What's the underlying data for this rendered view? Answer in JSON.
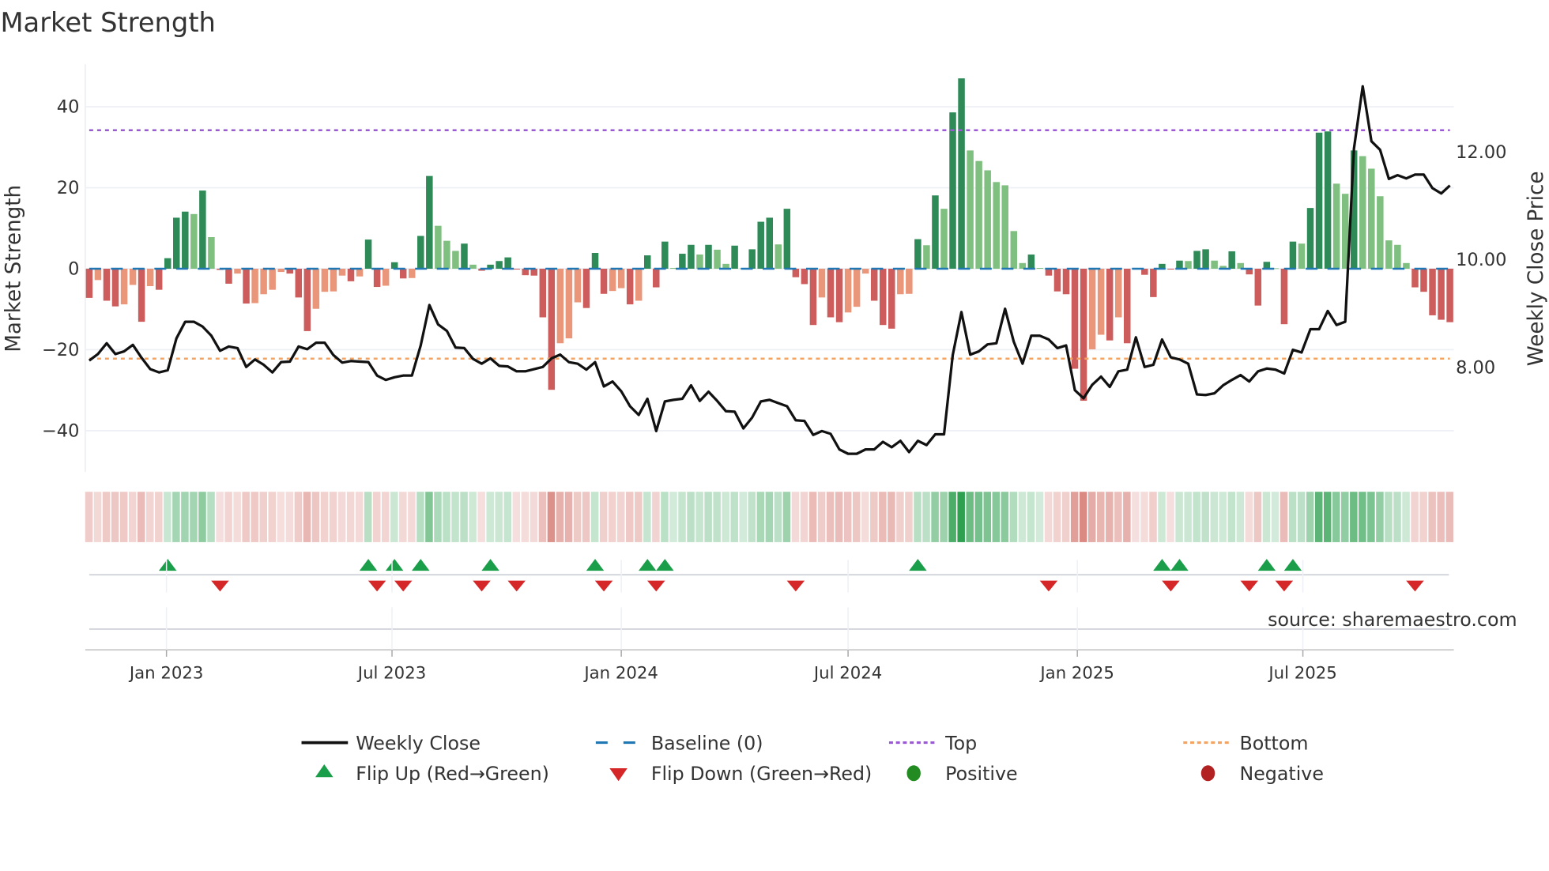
{
  "title": "Market Strength",
  "source": "source: sharemaestro.com",
  "chart_data": {
    "type": "bar",
    "frequency": "weekly",
    "xlim": [
      "2022-10-31",
      "2025-10-27"
    ],
    "x_ticks": [
      {
        "date": "2023-01-01",
        "label": "Jan 2023"
      },
      {
        "date": "2023-07-01",
        "label": "Jul 2023"
      },
      {
        "date": "2024-01-01",
        "label": "Jan 2024"
      },
      {
        "date": "2024-07-01",
        "label": "Jul 2024"
      },
      {
        "date": "2025-01-01",
        "label": "Jan 2025"
      },
      {
        "date": "2025-07-01",
        "label": "Jul 2025"
      }
    ],
    "left_axis": {
      "label": "Market Strength",
      "ylim": [
        -50.2,
        50.5
      ],
      "ticks": [
        40,
        20,
        0,
        -20,
        -40
      ],
      "tick_labels": [
        "40",
        "20",
        "0",
        "−20",
        "−40"
      ]
    },
    "right_axis": {
      "label": "Weekly Close Price",
      "ylim": [
        6.06,
        13.63
      ],
      "ticks": [
        12,
        10,
        8
      ],
      "tick_labels": [
        "12.00",
        "10.00",
        "8.00"
      ]
    },
    "grid": true,
    "baseline": 0,
    "top_level": 34.2,
    "bottom_level": -22.2,
    "strength": [
      -7.2,
      -2.8,
      -7.9,
      -9.3,
      -8.8,
      -4.0,
      -13.1,
      -4.3,
      -5.2,
      2.6,
      12.6,
      14.1,
      13.5,
      19.3,
      7.8,
      -0.3,
      -3.7,
      -1.2,
      -8.6,
      -8.5,
      -6.3,
      -5.2,
      -0.8,
      -1.2,
      -7.1,
      -15.4,
      -9.9,
      -5.7,
      -5.6,
      -1.7,
      -3.1,
      -1.9,
      7.2,
      -4.5,
      -4.2,
      1.6,
      -2.4,
      -2.3,
      8.1,
      22.9,
      10.6,
      6.9,
      4.4,
      6.2,
      1.0,
      -0.5,
      1.0,
      1.9,
      2.8,
      -0.2,
      -1.6,
      -1.7,
      -12.0,
      -29.9,
      -18.4,
      -17.2,
      -8.3,
      -9.7,
      3.9,
      -6.2,
      -5.5,
      -4.8,
      -8.8,
      -7.9,
      3.3,
      -4.6,
      6.7,
      0.2,
      3.7,
      5.9,
      3.5,
      5.9,
      4.7,
      1.2,
      5.7,
      0.1,
      4.8,
      11.6,
      12.6,
      6.0,
      14.8,
      -2.1,
      -3.8,
      -13.9,
      -7.1,
      -12.0,
      -13.2,
      -10.8,
      -9.4,
      -1.2,
      -7.9,
      -13.9,
      -14.8,
      -6.3,
      -6.2,
      7.3,
      5.8,
      18.1,
      14.8,
      38.6,
      47.0,
      29.2,
      26.6,
      24.3,
      21.4,
      20.6,
      9.3,
      1.4,
      3.5,
      0.2,
      -1.7,
      -5.6,
      -6.3,
      -24.7,
      -32.6,
      -19.9,
      -16.3,
      -17.7,
      -12.0,
      -18.4,
      -0.2,
      -1.5,
      -7.0,
      1.2,
      -0.2,
      2.0,
      1.9,
      4.4,
      4.8,
      2.0,
      0.7,
      4.3,
      1.4,
      -1.4,
      -9.1,
      1.7,
      0.1,
      -13.7,
      6.7,
      6.2,
      15.0,
      33.6,
      33.9,
      21.0,
      18.5,
      29.2,
      27.8,
      24.7,
      17.9,
      7.0,
      5.9,
      1.4,
      -4.6,
      -5.7,
      -11.5,
      -12.6,
      -13.2
    ],
    "weekly_close": [
      8.13,
      8.25,
      8.45,
      8.25,
      8.3,
      8.42,
      8.18,
      7.97,
      7.91,
      7.95,
      8.54,
      8.85,
      8.85,
      8.76,
      8.59,
      8.31,
      8.39,
      8.36,
      8.01,
      8.15,
      8.05,
      7.91,
      8.1,
      8.11,
      8.39,
      8.34,
      8.46,
      8.46,
      8.23,
      8.09,
      8.12,
      8.11,
      8.1,
      7.85,
      7.77,
      7.82,
      7.85,
      7.85,
      8.41,
      9.16,
      8.8,
      8.68,
      8.37,
      8.36,
      8.16,
      8.07,
      8.17,
      8.03,
      8.02,
      7.93,
      7.93,
      7.97,
      8.01,
      8.17,
      8.24,
      8.1,
      8.07,
      7.96,
      8.1,
      7.65,
      7.74,
      7.56,
      7.28,
      7.12,
      7.42,
      6.82,
      7.37,
      7.4,
      7.42,
      7.67,
      7.38,
      7.55,
      7.38,
      7.19,
      7.18,
      6.87,
      7.07,
      7.37,
      7.4,
      7.34,
      7.28,
      7.02,
      7.01,
      6.75,
      6.82,
      6.77,
      6.48,
      6.4,
      6.4,
      6.48,
      6.48,
      6.62,
      6.52,
      6.64,
      6.43,
      6.64,
      6.56,
      6.76,
      6.76,
      8.23,
      9.03,
      8.24,
      8.3,
      8.43,
      8.45,
      9.09,
      8.48,
      8.07,
      8.59,
      8.59,
      8.52,
      8.36,
      8.41,
      7.58,
      7.43,
      7.68,
      7.83,
      7.64,
      7.93,
      7.96,
      8.56,
      8.01,
      8.05,
      8.52,
      8.19,
      8.15,
      8.07,
      7.5,
      7.49,
      7.52,
      7.67,
      7.77,
      7.86,
      7.74,
      7.93,
      7.98,
      7.96,
      7.89,
      8.33,
      8.28,
      8.71,
      8.71,
      9.05,
      8.79,
      8.85,
      12.06,
      13.22,
      12.2,
      12.04,
      11.5,
      11.57,
      11.51,
      11.58,
      11.58,
      11.33,
      11.23,
      11.38
    ],
    "colors": {
      "positive_rising": "#2e8b57",
      "positive_falling": "#7fbf7f",
      "negative_falling": "#cd5c5c",
      "negative_rising": "#e9967a",
      "close_line": "#111111",
      "baseline": "#1f77b4",
      "top": "#9b59d6",
      "bottom": "#f4a460",
      "flip_up": "#1a9e4a",
      "flip_down": "#d62728",
      "positive": "#228b22",
      "negative": "#b22222"
    },
    "legend": {
      "placement": "bottom",
      "items": [
        {
          "label": "Weekly Close",
          "symbol": "solid-line"
        },
        {
          "label": "Baseline (0)",
          "symbol": "dashed-line"
        },
        {
          "label": "Top",
          "symbol": "dotted-line"
        },
        {
          "label": "Bottom",
          "symbol": "dotted-line"
        },
        {
          "label": "Flip Up (Red→Green)",
          "symbol": "triangle-up"
        },
        {
          "label": "Flip Down (Green→Red)",
          "symbol": "triangle-down"
        },
        {
          "label": "Positive",
          "symbol": "circle"
        },
        {
          "label": "Negative",
          "symbol": "circle"
        }
      ]
    }
  }
}
